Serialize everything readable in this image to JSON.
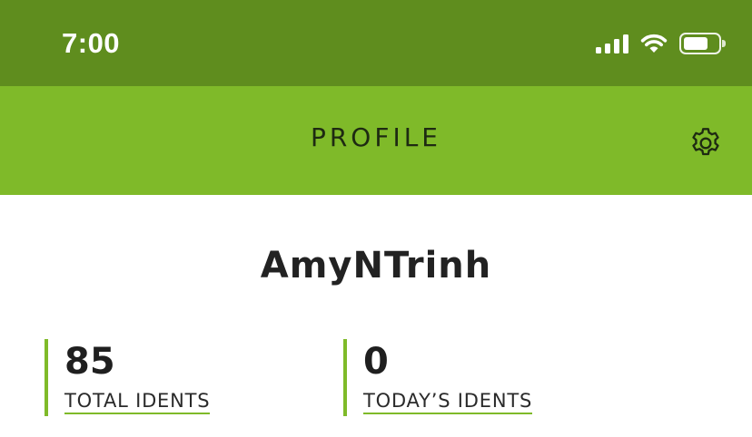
{
  "status_bar": {
    "time": "7:00",
    "icons": [
      "cellular-signal-icon",
      "wifi-icon",
      "battery-icon"
    ]
  },
  "app_bar": {
    "title": "PROFILE",
    "settings_icon": "gear-icon"
  },
  "profile": {
    "username": "AmyNTrinh",
    "stats": [
      {
        "value": "85",
        "label": "TOTAL IDENTS"
      },
      {
        "value": "0",
        "label": "TODAY’S IDENTS"
      }
    ]
  },
  "colors": {
    "status_bar_bg": "#5f8d1e",
    "app_bar_bg": "#7fba29",
    "accent": "#7fba29"
  }
}
